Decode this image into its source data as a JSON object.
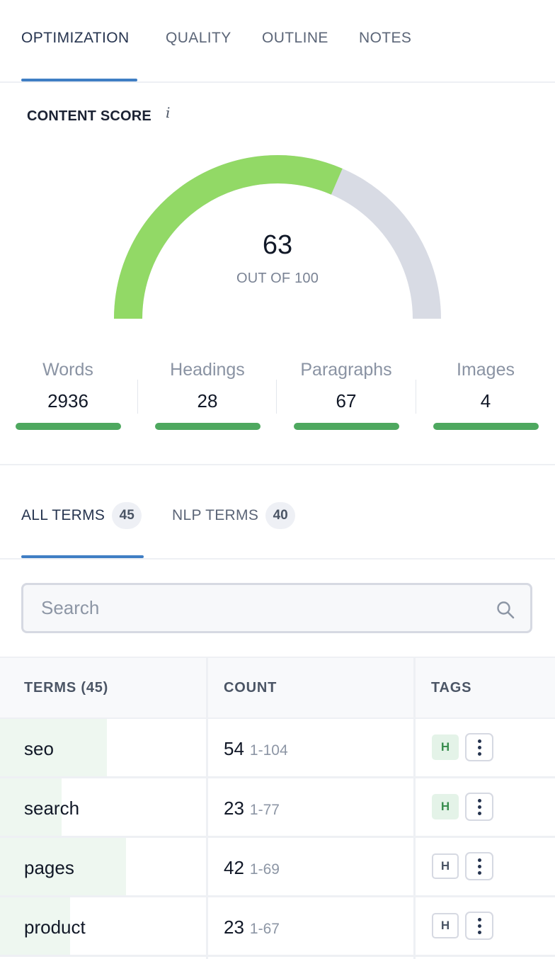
{
  "top_tabs": [
    {
      "label": "OPTIMIZATION",
      "active": true
    },
    {
      "label": "QUALITY",
      "active": false
    },
    {
      "label": "OUTLINE",
      "active": false
    },
    {
      "label": "NOTES",
      "active": false
    }
  ],
  "content_score": {
    "title": "CONTENT SCORE",
    "info_icon": "i",
    "value": 63,
    "value_text": "63",
    "subtitle": "OUT OF 100",
    "max": 100,
    "colors": {
      "fill": "#92d966",
      "track": "#d8dbe4"
    }
  },
  "stats": [
    {
      "label": "Words",
      "value": "2936",
      "progress": 1.0
    },
    {
      "label": "Headings",
      "value": "28",
      "progress": 1.0
    },
    {
      "label": "Paragraphs",
      "value": "67",
      "progress": 1.0
    },
    {
      "label": "Images",
      "value": "4",
      "progress": 1.0
    }
  ],
  "term_tabs": [
    {
      "label": "ALL TERMS",
      "count": "45",
      "active": true
    },
    {
      "label": "NLP TERMS",
      "count": "40",
      "active": false
    }
  ],
  "search": {
    "placeholder": "Search",
    "value": "",
    "icon": "search-icon"
  },
  "table": {
    "headers": {
      "terms": "TERMS  (45)",
      "count": "COUNT",
      "tags": "TAGS"
    },
    "rows": [
      {
        "term": "seo",
        "count": "54",
        "range": "1-104",
        "tag": "H",
        "tag_state": "hit",
        "fill": 0.52
      },
      {
        "term": "search",
        "count": "23",
        "range": "1-77",
        "tag": "H",
        "tag_state": "hit",
        "fill": 0.3
      },
      {
        "term": "pages",
        "count": "42",
        "range": "1-69",
        "tag": "H",
        "tag_state": "miss",
        "fill": 0.61
      },
      {
        "term": "product",
        "count": "23",
        "range": "1-67",
        "tag": "H",
        "tag_state": "miss",
        "fill": 0.34
      }
    ]
  }
}
